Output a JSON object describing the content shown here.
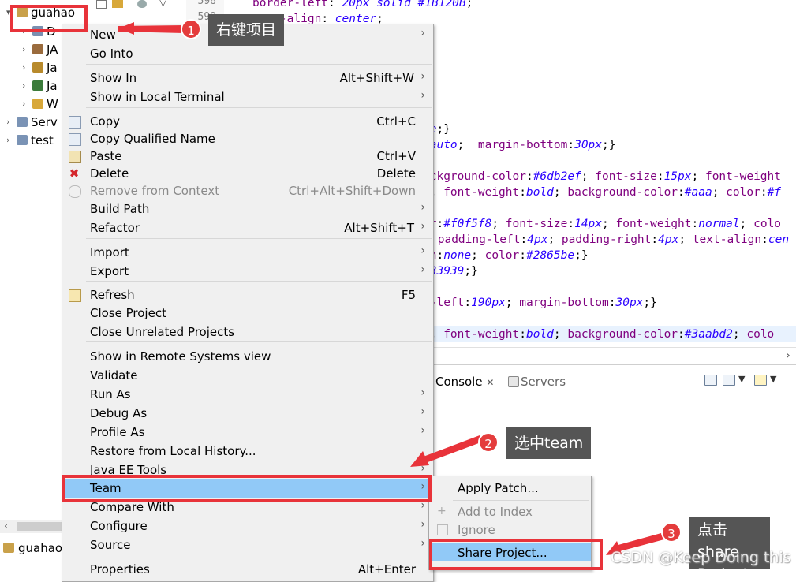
{
  "explorer": {
    "rows": [
      {
        "label": "guahao",
        "arrow": "▾"
      },
      {
        "label": "D",
        "arrow": "›"
      },
      {
        "label": "JA",
        "arrow": "›"
      },
      {
        "label": "Ja",
        "arrow": "›"
      },
      {
        "label": "Ja",
        "arrow": "›"
      },
      {
        "label": "W",
        "arrow": "›"
      },
      {
        "label": "Serv",
        "arrow": "›"
      },
      {
        "label": "test",
        "arrow": "›"
      }
    ],
    "status_label": "guahao"
  },
  "editor": {
    "line_numbers": [
      "598",
      "599"
    ],
    "lines": [
      {
        "parts": [
          [
            "prop",
            "border-left"
          ],
          [
            "txt",
            ": "
          ],
          [
            "val",
            "20px solid #1B120B"
          ],
          [
            "txt",
            ";"
          ]
        ]
      },
      {
        "parts": [
          [
            "prop",
            "text-align"
          ],
          [
            "txt",
            ": "
          ],
          [
            "val",
            "center"
          ],
          [
            "txt",
            ";"
          ]
        ]
      },
      {
        "parts": [
          [
            "txt",
            ";"
          ]
        ]
      },
      {
        "parts": [
          [
            "val",
            "se"
          ],
          [
            "txt",
            ";}"
          ]
        ]
      },
      {
        "parts": [
          [
            "txt",
            ":"
          ],
          [
            "val",
            "auto"
          ],
          [
            "txt",
            ";  "
          ],
          [
            "prop",
            "margin-bottom"
          ],
          [
            "txt",
            ":"
          ],
          [
            "val",
            "30px"
          ],
          [
            "txt",
            ";}"
          ]
        ]
      },
      {
        "parts": [
          [
            "prop",
            "ackground-color"
          ],
          [
            "txt",
            ":"
          ],
          [
            "val",
            "#6db2ef"
          ],
          [
            "txt",
            "; "
          ],
          [
            "prop",
            "font-size"
          ],
          [
            "txt",
            ":"
          ],
          [
            "val",
            "15px"
          ],
          [
            "txt",
            "; "
          ],
          [
            "prop",
            "font-weight"
          ]
        ]
      },
      {
        "parts": [
          [
            "val",
            "x"
          ],
          [
            "txt",
            "; "
          ],
          [
            "prop",
            "font-weight"
          ],
          [
            "txt",
            ":"
          ],
          [
            "val",
            "bold"
          ],
          [
            "txt",
            "; "
          ],
          [
            "prop",
            "background-color"
          ],
          [
            "txt",
            ":"
          ],
          [
            "val",
            "#aaa"
          ],
          [
            "txt",
            "; "
          ],
          [
            "prop",
            "color"
          ],
          [
            "txt",
            ":"
          ],
          [
            "val",
            "#f"
          ]
        ]
      },
      {
        "parts": [
          [
            "prop",
            "or"
          ],
          [
            "txt",
            ":"
          ],
          [
            "val",
            "#f0f5f8"
          ],
          [
            "txt",
            "; "
          ],
          [
            "prop",
            "font-size"
          ],
          [
            "txt",
            ":"
          ],
          [
            "val",
            "14px"
          ],
          [
            "txt",
            "; "
          ],
          [
            "prop",
            "font-weight"
          ],
          [
            "txt",
            ":"
          ],
          [
            "val",
            "normal"
          ],
          [
            "txt",
            "; "
          ],
          [
            "prop",
            "colo"
          ]
        ]
      },
      {
        "parts": [
          [
            "txt",
            " "
          ],
          [
            "prop",
            "padding-left"
          ],
          [
            "txt",
            ":"
          ],
          [
            "val",
            "4px"
          ],
          [
            "txt",
            "; "
          ],
          [
            "prop",
            "padding-right"
          ],
          [
            "txt",
            ":"
          ],
          [
            "val",
            "4px"
          ],
          [
            "txt",
            "; "
          ],
          [
            "prop",
            "text-align"
          ],
          [
            "txt",
            ":"
          ],
          [
            "val",
            "cen"
          ]
        ]
      },
      {
        "parts": [
          [
            "prop",
            "on"
          ],
          [
            "txt",
            ":"
          ],
          [
            "val",
            "none"
          ],
          [
            "txt",
            "; "
          ],
          [
            "prop",
            "color"
          ],
          [
            "txt",
            ":"
          ],
          [
            "val",
            "#2865be"
          ],
          [
            "txt",
            ";}"
          ]
        ]
      },
      {
        "parts": [
          [
            "val",
            "d33939"
          ],
          [
            "txt",
            ";}"
          ]
        ]
      },
      {
        "parts": [
          [
            "prop",
            "n-left"
          ],
          [
            "txt",
            ":"
          ],
          [
            "val",
            "190px"
          ],
          [
            "txt",
            "; "
          ],
          [
            "prop",
            "margin-bottom"
          ],
          [
            "txt",
            ":"
          ],
          [
            "val",
            "30px"
          ],
          [
            "txt",
            ";}"
          ]
        ]
      },
      {
        "parts": [
          [
            "val",
            "x"
          ],
          [
            "txt",
            "; "
          ],
          [
            "prop",
            "font-weight"
          ],
          [
            "txt",
            ":"
          ],
          [
            "val",
            "bold"
          ],
          [
            "txt",
            "; "
          ],
          [
            "prop",
            "background-color"
          ],
          [
            "txt",
            ":"
          ],
          [
            "val",
            "#3aabd2"
          ],
          [
            "txt",
            "; "
          ],
          [
            "prop",
            "colo"
          ]
        ]
      }
    ]
  },
  "console": {
    "tab_console": "Console",
    "tab_close": "✕",
    "tab_servers": "Servers"
  },
  "context_menu": {
    "items": [
      {
        "label": "New",
        "accel": "",
        "sub": true,
        "disabled": false,
        "icon": ""
      },
      {
        "label": "Go Into",
        "accel": "",
        "sub": false,
        "disabled": false,
        "icon": ""
      },
      {
        "label": "Show In",
        "accel": "Alt+Shift+W",
        "sub": true,
        "disabled": false,
        "icon": ""
      },
      {
        "label": "Show in Local Terminal",
        "accel": "",
        "sub": true,
        "disabled": false,
        "icon": ""
      },
      {
        "label": "Copy",
        "accel": "Ctrl+C",
        "sub": false,
        "disabled": false,
        "icon": "copy-icon"
      },
      {
        "label": "Copy Qualified Name",
        "accel": "",
        "sub": false,
        "disabled": false,
        "icon": "copy-qualified-icon"
      },
      {
        "label": "Paste",
        "accel": "Ctrl+V",
        "sub": false,
        "disabled": false,
        "icon": "paste-icon"
      },
      {
        "label": "Delete",
        "accel": "Delete",
        "sub": false,
        "disabled": false,
        "icon": "delete-icon"
      },
      {
        "label": "Remove from Context",
        "accel": "Ctrl+Alt+Shift+Down",
        "sub": false,
        "disabled": true,
        "icon": "remove-context-icon"
      },
      {
        "label": "Build Path",
        "accel": "",
        "sub": true,
        "disabled": false,
        "icon": ""
      },
      {
        "label": "Refactor",
        "accel": "Alt+Shift+T",
        "sub": true,
        "disabled": false,
        "icon": ""
      },
      {
        "label": "Import",
        "accel": "",
        "sub": true,
        "disabled": false,
        "icon": ""
      },
      {
        "label": "Export",
        "accel": "",
        "sub": true,
        "disabled": false,
        "icon": ""
      },
      {
        "label": "Refresh",
        "accel": "F5",
        "sub": false,
        "disabled": false,
        "icon": "refresh-icon"
      },
      {
        "label": "Close Project",
        "accel": "",
        "sub": false,
        "disabled": false,
        "icon": ""
      },
      {
        "label": "Close Unrelated Projects",
        "accel": "",
        "sub": false,
        "disabled": false,
        "icon": ""
      },
      {
        "label": "Show in Remote Systems view",
        "accel": "",
        "sub": false,
        "disabled": false,
        "icon": ""
      },
      {
        "label": "Validate",
        "accel": "",
        "sub": false,
        "disabled": false,
        "icon": ""
      },
      {
        "label": "Run As",
        "accel": "",
        "sub": true,
        "disabled": false,
        "icon": ""
      },
      {
        "label": "Debug As",
        "accel": "",
        "sub": true,
        "disabled": false,
        "icon": ""
      },
      {
        "label": "Profile As",
        "accel": "",
        "sub": true,
        "disabled": false,
        "icon": ""
      },
      {
        "label": "Restore from Local History...",
        "accel": "",
        "sub": false,
        "disabled": false,
        "icon": ""
      },
      {
        "label": "Java EE Tools",
        "accel": "",
        "sub": true,
        "disabled": false,
        "icon": ""
      },
      {
        "label": "Team",
        "accel": "",
        "sub": true,
        "disabled": false,
        "icon": "",
        "selected": true
      },
      {
        "label": "Compare With",
        "accel": "",
        "sub": true,
        "disabled": false,
        "icon": ""
      },
      {
        "label": "Configure",
        "accel": "",
        "sub": true,
        "disabled": false,
        "icon": ""
      },
      {
        "label": "Source",
        "accel": "",
        "sub": true,
        "disabled": false,
        "icon": ""
      },
      {
        "label": "Properties",
        "accel": "Alt+Enter",
        "sub": false,
        "disabled": false,
        "icon": ""
      }
    ]
  },
  "team_menu": {
    "items": [
      {
        "label": "Apply Patch...",
        "disabled": false,
        "icon": ""
      },
      {
        "label": "Add to Index",
        "disabled": true,
        "icon": "add-index-icon"
      },
      {
        "label": "Ignore",
        "disabled": true,
        "icon": "ignore-icon"
      },
      {
        "label": "Share Project...",
        "disabled": false,
        "icon": "",
        "selected": true
      }
    ]
  },
  "annotations": {
    "step1_num": "1",
    "step1_text": "右键项目",
    "step2_num": "2",
    "step2_text": "选中team",
    "step3_num": "3",
    "step3_text": "点击share Project",
    "accent": "#e8333a",
    "watermark": "CSDN @Keep Doing this"
  },
  "colors": {
    "selection": "#91c9f7",
    "menu_bg": "#f0f0f0",
    "css_property": "#7f007f",
    "css_value": "#2a00ff"
  }
}
